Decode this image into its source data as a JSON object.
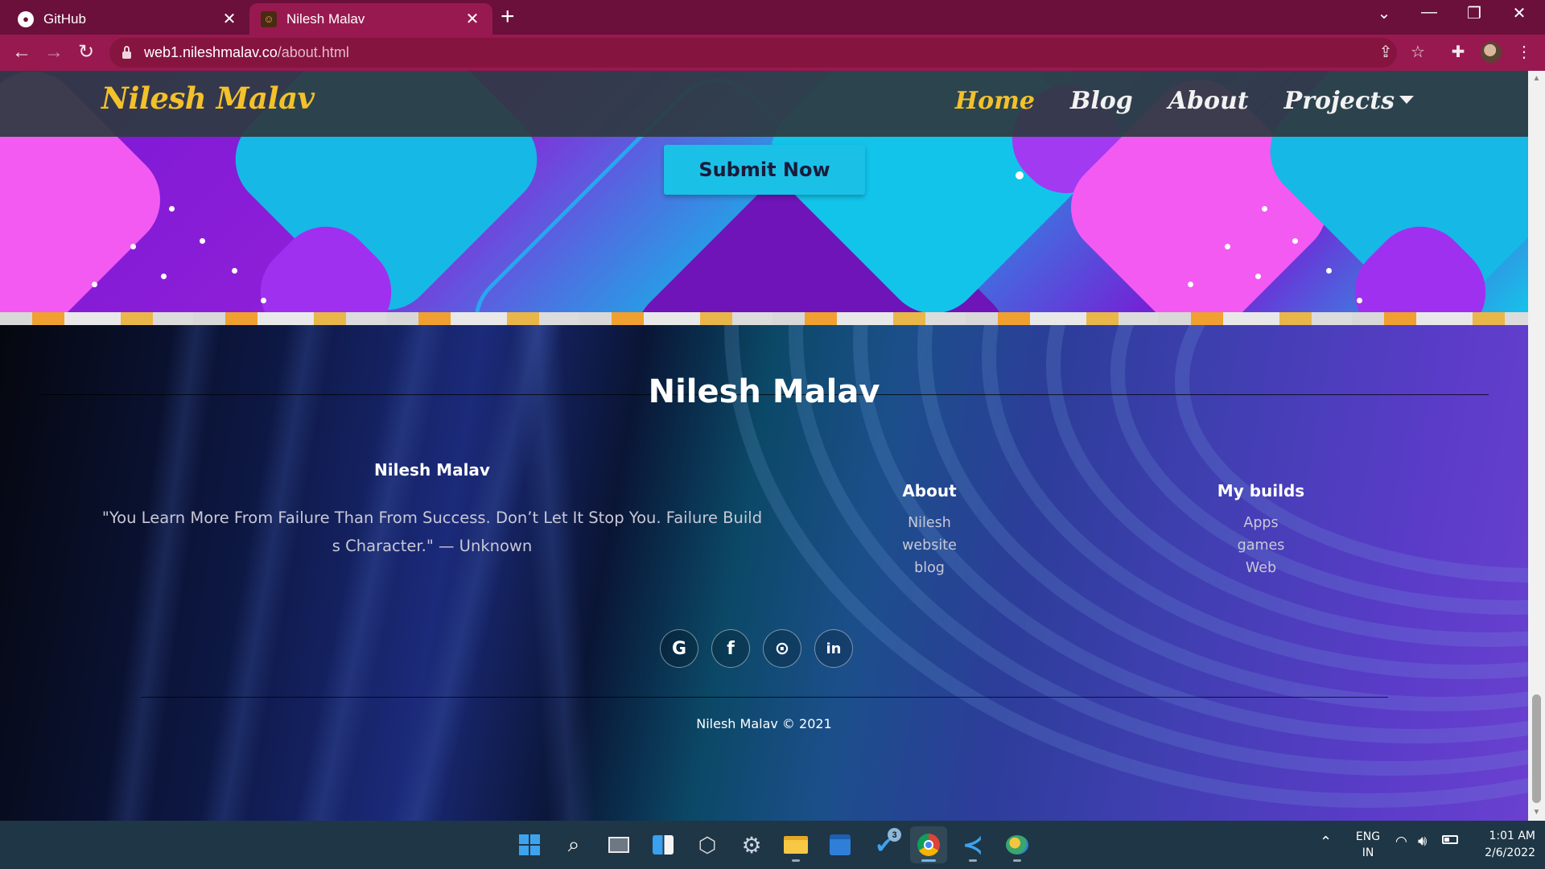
{
  "browser": {
    "tabs": [
      {
        "title": "GitHub",
        "favicon": "github-icon",
        "active": false
      },
      {
        "title": "Nilesh Malav",
        "favicon": "site-icon",
        "active": true
      }
    ],
    "url_host": "web1.nileshmalav.co",
    "url_path": "/about.html"
  },
  "site": {
    "brand": "Nilesh Malav",
    "nav": [
      "Home",
      "Blog",
      "About",
      "Projects"
    ],
    "active_nav": "Home",
    "submit_label": "Submit Now"
  },
  "footer": {
    "title": "Nilesh Malav",
    "about_name": "Nilesh Malav",
    "quote": "\"You Learn More From Failure Than From Success. Don’t Let It Stop You. Failure Builds Character.\"  — Unknown",
    "columns": [
      {
        "heading": "About",
        "links": [
          "Nilesh",
          "website",
          "blog"
        ]
      },
      {
        "heading": "My builds",
        "links": [
          "Apps",
          "games",
          "Web"
        ]
      }
    ],
    "socials": [
      {
        "name": "google-icon",
        "glyph": "G"
      },
      {
        "name": "facebook-icon",
        "glyph": "f"
      },
      {
        "name": "github-icon",
        "glyph": "⊙"
      },
      {
        "name": "linkedin-icon",
        "glyph": "in"
      }
    ],
    "copyright": "Nilesh Malav © 2021"
  },
  "taskbar": {
    "language": "ENG",
    "region": "IN",
    "time": "1:01 AM",
    "date": "2/6/2022",
    "todo_badge": "3"
  },
  "colors": {
    "tab_strip": "#6b0f3b",
    "toolbar": "#98194f",
    "brand_yellow": "#f3c12a",
    "submit_cyan": "#1bc0e6",
    "taskbar": "#1e3646"
  }
}
